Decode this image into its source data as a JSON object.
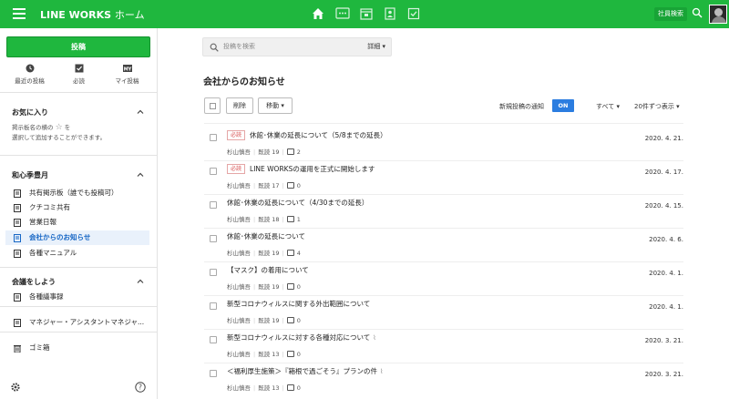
{
  "header": {
    "app_name": "LINE WORKS",
    "app_sub": "ホーム",
    "employee_search": "社員検索",
    "nav_icons": [
      "home-icon",
      "talk-icon",
      "calendar-icon",
      "contacts-icon",
      "task-icon"
    ],
    "brand_color": "#1fb73e"
  },
  "sidebar": {
    "post_button": "投稿",
    "quick": [
      {
        "label": "最近の投稿",
        "icon": "clock-icon"
      },
      {
        "label": "必読",
        "icon": "checkbox-icon"
      },
      {
        "label": "マイ投稿",
        "icon": "my-icon"
      }
    ],
    "my_badge": "MY",
    "favorites_title": "お気に入り",
    "favorites_hint_1": "掲示板名の横の",
    "favorites_hint_2": "を",
    "favorites_hint_3": "選択して追加することができます。",
    "group_title": "和心季豊月",
    "boards": [
      "共有掲示板（誰でも投稿可）",
      "クチコミ共有",
      "営業日報",
      "会社からのお知らせ",
      "各種マニュアル"
    ],
    "meeting_title": "会議をしよう",
    "meeting_items": [
      "各種議事録",
      "マネジャー・アシスタントマネジャ..."
    ],
    "trash": "ゴミ箱"
  },
  "main": {
    "search_placeholder": "投稿を検索",
    "advanced": "詳細",
    "page_title": "会社からのお知らせ",
    "delete_btn": "削除",
    "move_btn": "移動",
    "notify_label": "新規投稿の通知",
    "notify_toggle": "ON",
    "filter_all": "すべて",
    "per_page": "20件ずつ表示",
    "accent": "#2b7de0"
  },
  "posts": [
    {
      "badge": "必読",
      "title": "休館･休業の延長について（5/8までの延長）",
      "author": "杉山慎吾",
      "views": "既読 19",
      "comments": "2",
      "date": "2020. 4. 21."
    },
    {
      "badge": "必読",
      "title": "LINE WORKSの運用を正式に開始します",
      "author": "杉山慎吾",
      "views": "既読 17",
      "comments": "0",
      "date": "2020. 4. 17."
    },
    {
      "badge": "",
      "title": "休館･休業の延長について（4/30までの延長）",
      "author": "杉山慎吾",
      "views": "既読 18",
      "comments": "1",
      "date": "2020. 4. 15."
    },
    {
      "badge": "",
      "title": "休館･休業の延長について",
      "author": "杉山慎吾",
      "views": "既読 19",
      "comments": "4",
      "date": "2020. 4. 6."
    },
    {
      "badge": "",
      "title": "【マスク】の着用について",
      "author": "杉山慎吾",
      "views": "既読 19",
      "comments": "0",
      "date": "2020. 4. 1."
    },
    {
      "badge": "",
      "title": "新型コロナウィルスに関する外出範囲について",
      "author": "杉山慎吾",
      "views": "既読 19",
      "comments": "0",
      "date": "2020. 4. 1."
    },
    {
      "badge": "",
      "title": "新型コロナウィルスに対する各種対応について",
      "author": "杉山慎吾",
      "views": "既読 13",
      "comments": "0",
      "date": "2020. 3. 21."
    },
    {
      "badge": "",
      "title": "＜福利厚生施策＞『箱根で過ごそう』プランの件",
      "author": "杉山慎吾",
      "views": "既読 13",
      "comments": "0",
      "date": "2020. 3. 21."
    }
  ]
}
